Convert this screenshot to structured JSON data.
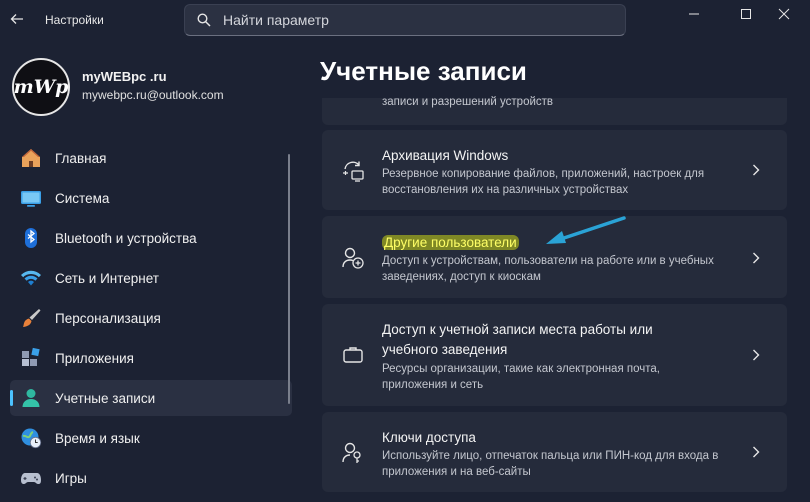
{
  "app": {
    "title": "Настройки"
  },
  "search": {
    "placeholder": "Найти параметр"
  },
  "account": {
    "avatar_text": "mWp",
    "name": "myWEBpc .ru",
    "email": "mywebpc.ru@outlook.com"
  },
  "nav": [
    {
      "label": "Главная",
      "icon": "home-icon"
    },
    {
      "label": "Система",
      "icon": "system-icon"
    },
    {
      "label": "Bluetooth и устройства",
      "icon": "bluetooth-icon"
    },
    {
      "label": "Сеть и Интернет",
      "icon": "wifi-icon"
    },
    {
      "label": "Персонализация",
      "icon": "brush-icon"
    },
    {
      "label": "Приложения",
      "icon": "apps-icon"
    },
    {
      "label": "Учетные записи",
      "icon": "accounts-icon",
      "active": true
    },
    {
      "label": "Время и язык",
      "icon": "globe-clock-icon"
    },
    {
      "label": "Игры",
      "icon": "gamepad-icon"
    }
  ],
  "main": {
    "title": "Учетные записи",
    "partial_card": {
      "desc": "записи и разрешений устройств"
    },
    "cards": [
      {
        "title": "Архивация Windows",
        "desc": "Резервное копирование файлов, приложений, настроек для восстановления их на различных устройствах",
        "icon": "backup-icon"
      },
      {
        "title": "Другие пользователи",
        "desc": "Доступ к устройствам, пользователи на работе или в учебных заведениях, доступ к киоскам",
        "icon": "add-user-icon"
      },
      {
        "title": "Доступ к учетной записи места работы или учебного заведения",
        "desc": "Ресурсы организации, такие как электронная почта, приложения и сеть",
        "icon": "briefcase-icon"
      },
      {
        "title": "Ключи доступа",
        "desc": "Используйте лицо, отпечаток пальца или ПИН-код для входа в приложения и на веб-сайты",
        "icon": "passkey-icon"
      }
    ]
  },
  "colors": {
    "accent": "#4cc2ff",
    "background": "#1c2233",
    "card": "#252b3b",
    "highlight": "#cbd614",
    "arrow": "#2aa3d6"
  }
}
